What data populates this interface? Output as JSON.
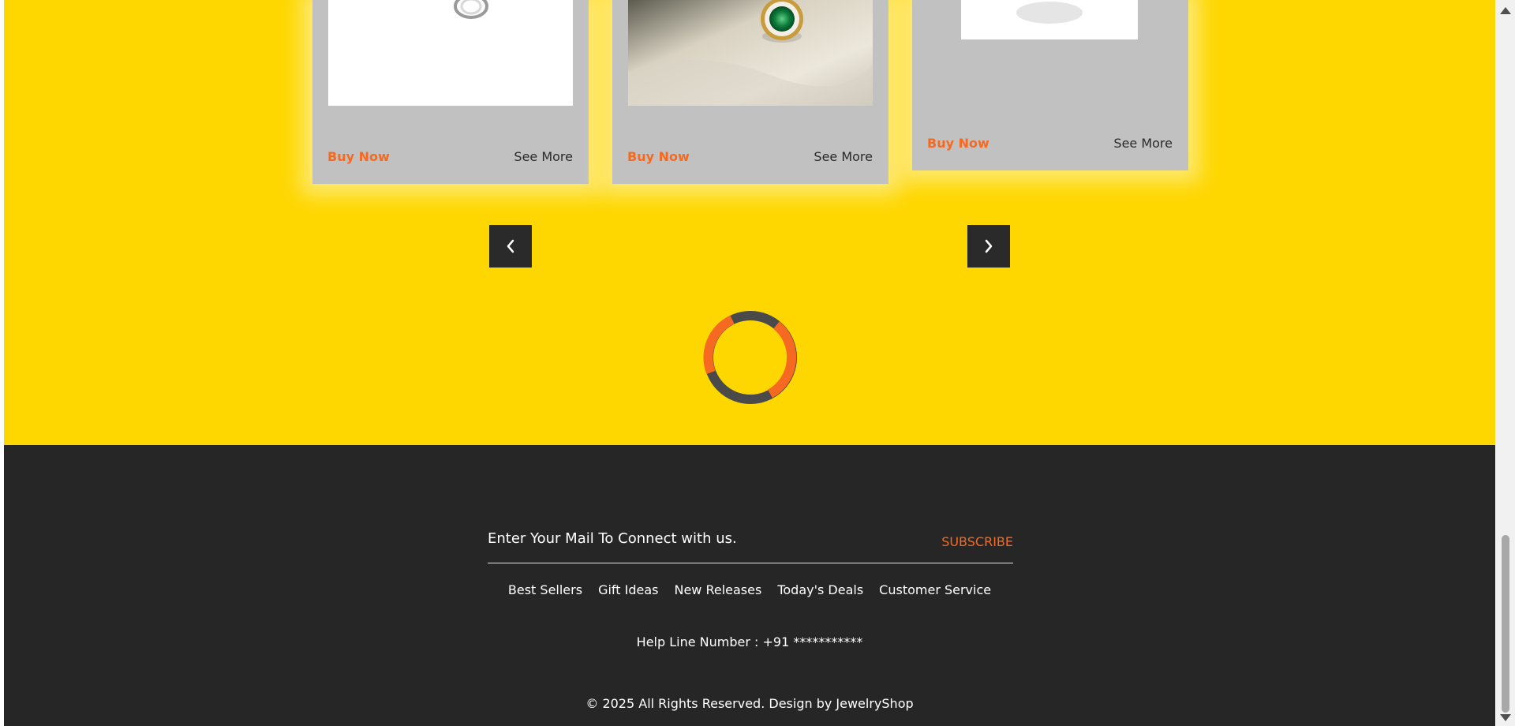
{
  "products": [
    {
      "buy_label": "Buy Now",
      "more_label": "See More"
    },
    {
      "buy_label": "Buy Now",
      "more_label": "See More"
    },
    {
      "buy_label": "Buy Now",
      "more_label": "See More"
    }
  ],
  "carousel": {
    "prev_icon": "chevron-left-icon",
    "next_icon": "chevron-right-icon"
  },
  "footer": {
    "newsletter_text": "Enter Your Mail To Connect with us.",
    "subscribe_label": "SUBSCRIBE",
    "links": [
      "Best Sellers",
      "Gift Ideas",
      "New Releases",
      "Today's Deals",
      "Customer Service"
    ],
    "helpline": "Help Line Number : +91 ***********",
    "copyright": "© 2025 All Rights Reserved. Design by JewelryShop"
  },
  "colors": {
    "accent": "#f56a20",
    "yellow_bg": "#fed700",
    "footer_bg": "#262626",
    "card_bg": "#c1c1c1",
    "loader_dark": "#4a4a4a"
  }
}
